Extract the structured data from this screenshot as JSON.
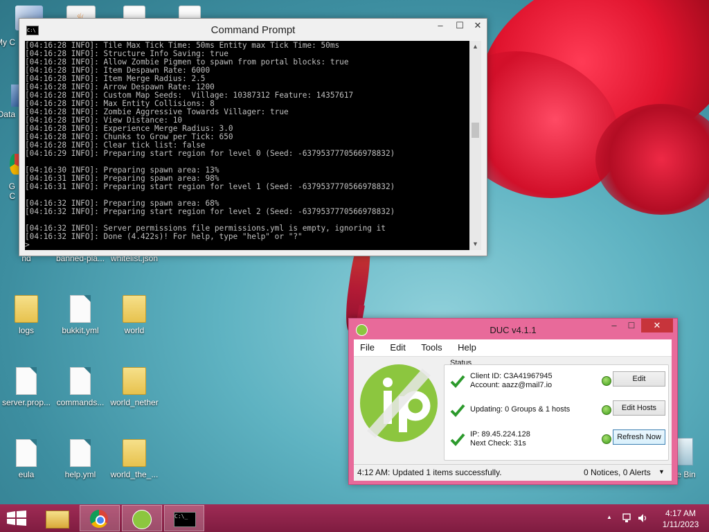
{
  "desktop": {
    "icons": [
      {
        "label": "My C"
      },
      {
        "label": "Data"
      },
      {
        "label": "G"
      },
      {
        "label": "C"
      },
      {
        "label": "nd"
      },
      {
        "label": "banned-pla..."
      },
      {
        "label": "whitelist.json"
      },
      {
        "label": "logs"
      },
      {
        "label": "bukkit.yml"
      },
      {
        "label": "world"
      },
      {
        "label": "server.prop..."
      },
      {
        "label": "commands..."
      },
      {
        "label": "world_nether"
      },
      {
        "label": "eula"
      },
      {
        "label": "help.yml"
      },
      {
        "label": "world_the_..."
      },
      {
        "label": "e Bin"
      }
    ]
  },
  "cmd": {
    "title": "Command Prompt",
    "icon_text": "C:\\",
    "min": "–",
    "max": "☐",
    "close": "✕",
    "output": "[04:16:28 INFO]: Tile Max Tick Time: 50ms Entity max Tick Time: 50ms\n[04:16:28 INFO]: Structure Info Saving: true\n[04:16:28 INFO]: Allow Zombie Pigmen to spawn from portal blocks: true\n[04:16:28 INFO]: Item Despawn Rate: 6000\n[04:16:28 INFO]: Item Merge Radius: 2.5\n[04:16:28 INFO]: Arrow Despawn Rate: 1200\n[04:16:28 INFO]: Custom Map Seeds:  Village: 10387312 Feature: 14357617\n[04:16:28 INFO]: Max Entity Collisions: 8\n[04:16:28 INFO]: Zombie Aggressive Towards Villager: true\n[04:16:28 INFO]: View Distance: 10\n[04:16:28 INFO]: Experience Merge Radius: 3.0\n[04:16:28 INFO]: Chunks to Grow per Tick: 650\n[04:16:28 INFO]: Clear tick list: false\n[04:16:29 INFO]: Preparing start region for level 0 (Seed: -6379537770566978832)\n\n[04:16:30 INFO]: Preparing spawn area: 13%\n[04:16:31 INFO]: Preparing spawn area: 98%\n[04:16:31 INFO]: Preparing start region for level 1 (Seed: -6379537770566978832)\n\n[04:16:32 INFO]: Preparing spawn area: 68%\n[04:16:32 INFO]: Preparing start region for level 2 (Seed: -6379537770566978832)\n\n[04:16:32 INFO]: Server permissions file permissions.yml is empty, ignoring it\n[04:16:32 INFO]: Done (4.422s)! For help, type \"help\" or \"?\"\n>"
  },
  "duc": {
    "title": "DUC v4.1.1",
    "close": "✕",
    "min": "–",
    "max": "☐",
    "menu": [
      "File",
      "Edit",
      "Tools",
      "Help"
    ],
    "status_label": "Status",
    "rows": [
      {
        "line1": "Client ID: C3A41967945",
        "line2": "Account: aazz@mail7.io",
        "button": "Edit"
      },
      {
        "line1": "Updating: 0 Groups & 1 hosts",
        "line2": "",
        "button": "Edit Hosts"
      },
      {
        "line1": "IP: 89.45.224.128",
        "line2": "Next Check: 31s",
        "button": "Refresh Now"
      }
    ],
    "statusbar_left": "4:12 AM: Updated 1 items successfully.",
    "statusbar_right": "0 Notices, 0 Alerts",
    "statusbar_caret": "▼"
  },
  "taskbar": {
    "cmd_glyph": "C:\\_",
    "tray_up": "▲",
    "time": "4:17 AM",
    "date": "1/11/2023"
  },
  "colors": {
    "duc_frame": "#e86a9a",
    "taskbar": "#8f2349",
    "logo_green": "#8cc63f",
    "close_red": "#c7343b"
  }
}
